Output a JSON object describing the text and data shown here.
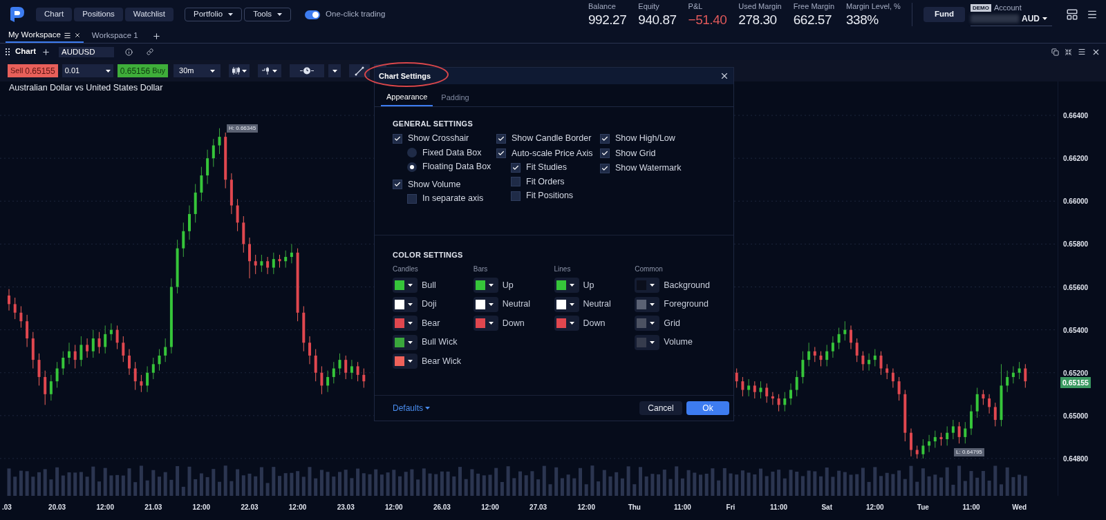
{
  "top_nav": {
    "buttons": [
      "Chart",
      "Positions",
      "Watchlist"
    ],
    "menus": [
      "Portfolio",
      "Tools"
    ],
    "one_click": {
      "label": "One-click trading",
      "on": true
    }
  },
  "account_stats": [
    {
      "label": "Balance",
      "value": "992.27",
      "kind": "normal"
    },
    {
      "label": "Equity",
      "value": "940.87",
      "kind": "normal"
    },
    {
      "label": "P&L",
      "value": "−51.40",
      "kind": "loss"
    },
    {
      "label": "Used Margin",
      "value": "278.30",
      "kind": "normal"
    },
    {
      "label": "Free Margin",
      "value": "662.57",
      "kind": "normal"
    },
    {
      "label": "Margin Level, %",
      "value": "338%",
      "kind": "normal"
    }
  ],
  "fund_button": "Fund",
  "account": {
    "badge": "DEMO",
    "label": "Account",
    "currency": "AUD"
  },
  "workspace_tabs": [
    {
      "label": "My Workspace",
      "selected": true
    },
    {
      "label": "Workspace 1",
      "selected": false
    }
  ],
  "chart_panel": {
    "title": "Chart",
    "symbol": "AUDUSD"
  },
  "toolbar": {
    "sell": {
      "label": "Sell",
      "price": "0.65155"
    },
    "quantity": "0.01",
    "buy": {
      "price": "0.65156",
      "label": "Buy"
    },
    "timeframe": "30m"
  },
  "instrument_title": "Australian Dollar vs United States Dollar",
  "chart_data": {
    "type": "candlestick",
    "yticks": [
      {
        "value": 0.664,
        "label": "0.66400"
      },
      {
        "value": 0.662,
        "label": "0.66200"
      },
      {
        "value": 0.66,
        "label": "0.66000"
      },
      {
        "value": 0.658,
        "label": "0.65800"
      },
      {
        "value": 0.656,
        "label": "0.65600"
      },
      {
        "value": 0.654,
        "label": "0.65400"
      },
      {
        "value": 0.652,
        "label": "0.65200"
      },
      {
        "value": 0.65,
        "label": "0.65000"
      },
      {
        "value": 0.648,
        "label": "0.64800"
      }
    ],
    "ylim": [
      0.64626,
      0.66558
    ],
    "grid": true,
    "ohlc": [
      [
        0.6556,
        0.6559,
        0.6549,
        0.6552
      ],
      [
        0.6552,
        0.6555,
        0.6545,
        0.6548
      ],
      [
        0.6548,
        0.6551,
        0.6541,
        0.6544
      ],
      [
        0.6544,
        0.6547,
        0.6532,
        0.6536
      ],
      [
        0.6536,
        0.6539,
        0.6522,
        0.6526
      ],
      [
        0.6526,
        0.6529,
        0.6514,
        0.6518
      ],
      [
        0.6518,
        0.6521,
        0.6505,
        0.651
      ],
      [
        0.651,
        0.6519,
        0.6507,
        0.6516
      ],
      [
        0.6516,
        0.6525,
        0.6513,
        0.6522
      ],
      [
        0.6522,
        0.653,
        0.6519,
        0.6527
      ],
      [
        0.6527,
        0.6534,
        0.6524,
        0.653
      ],
      [
        0.653,
        0.6533,
        0.6522,
        0.6526
      ],
      [
        0.6526,
        0.6537,
        0.6523,
        0.6533
      ],
      [
        0.6533,
        0.6536,
        0.6527,
        0.653
      ],
      [
        0.653,
        0.654,
        0.6527,
        0.6536
      ],
      [
        0.6536,
        0.6539,
        0.6529,
        0.6532
      ],
      [
        0.6532,
        0.6542,
        0.6529,
        0.6538
      ],
      [
        0.6538,
        0.6543,
        0.6535,
        0.654
      ],
      [
        0.654,
        0.6542,
        0.6531,
        0.6534
      ],
      [
        0.6534,
        0.6537,
        0.6525,
        0.6528
      ],
      [
        0.6528,
        0.6531,
        0.6519,
        0.6522
      ],
      [
        0.6522,
        0.6525,
        0.6512,
        0.6516
      ],
      [
        0.6516,
        0.6519,
        0.6511,
        0.6514
      ],
      [
        0.6514,
        0.6523,
        0.6511,
        0.652
      ],
      [
        0.652,
        0.6527,
        0.6517,
        0.6524
      ],
      [
        0.6524,
        0.6531,
        0.6521,
        0.6528
      ],
      [
        0.6528,
        0.6536,
        0.6525,
        0.6532
      ],
      [
        0.6532,
        0.6564,
        0.6529,
        0.656
      ],
      [
        0.656,
        0.6582,
        0.6557,
        0.6578
      ],
      [
        0.6578,
        0.659,
        0.6574,
        0.6586
      ],
      [
        0.6586,
        0.6598,
        0.6582,
        0.6594
      ],
      [
        0.6594,
        0.6608,
        0.659,
        0.6604
      ],
      [
        0.6604,
        0.6616,
        0.66,
        0.6612
      ],
      [
        0.6612,
        0.6624,
        0.6608,
        0.662
      ],
      [
        0.662,
        0.6629,
        0.6616,
        0.6626
      ],
      [
        0.6626,
        0.6634,
        0.6622,
        0.663
      ],
      [
        0.663,
        0.6632,
        0.6606,
        0.661
      ],
      [
        0.661,
        0.6613,
        0.6594,
        0.6598
      ],
      [
        0.6598,
        0.6601,
        0.6586,
        0.659
      ],
      [
        0.659,
        0.6593,
        0.6576,
        0.658
      ],
      [
        0.658,
        0.6583,
        0.6564,
        0.6572
      ],
      [
        0.6572,
        0.6575,
        0.6566,
        0.657
      ],
      [
        0.657,
        0.6575,
        0.6567,
        0.6572
      ],
      [
        0.6572,
        0.6574,
        0.6566,
        0.6569
      ],
      [
        0.6569,
        0.6576,
        0.6566,
        0.6573
      ],
      [
        0.6573,
        0.6575,
        0.6569,
        0.6572
      ],
      [
        0.6572,
        0.6577,
        0.6569,
        0.6574
      ],
      [
        0.6574,
        0.658,
        0.6571,
        0.6576
      ],
      [
        0.6576,
        0.6578,
        0.6544,
        0.6548
      ],
      [
        0.6548,
        0.6551,
        0.653,
        0.6534
      ],
      [
        0.6534,
        0.6537,
        0.6524,
        0.6528
      ],
      [
        0.6528,
        0.6531,
        0.6516,
        0.652
      ],
      [
        0.652,
        0.6523,
        0.651,
        0.6514
      ],
      [
        0.6514,
        0.6521,
        0.6511,
        0.6518
      ],
      [
        0.6518,
        0.6525,
        0.6515,
        0.6522
      ],
      [
        0.6522,
        0.6529,
        0.6519,
        0.6526
      ],
      [
        0.6526,
        0.6528,
        0.6517,
        0.652
      ],
      [
        0.652,
        0.6526,
        0.6517,
        0.6523
      ],
      [
        0.6523,
        0.6525,
        0.6516,
        0.6519
      ],
      [
        0.6519,
        0.6522,
        0.6513,
        0.6516
      ],
      null,
      null,
      null,
      null,
      null,
      null,
      null,
      null,
      null,
      null,
      null,
      null,
      null,
      null,
      null,
      null,
      null,
      null,
      null,
      null,
      null,
      null,
      null,
      null,
      null,
      null,
      null,
      null,
      null,
      null,
      null,
      null,
      null,
      null,
      null,
      null,
      null,
      null,
      null,
      null,
      null,
      null,
      null,
      null,
      null,
      null,
      null,
      null,
      null,
      null,
      null,
      null,
      null,
      null,
      null,
      null,
      null,
      null,
      null,
      null,
      null,
      [
        0.652,
        0.6522,
        0.6513,
        0.6516
      ],
      [
        0.6516,
        0.6518,
        0.6509,
        0.6512
      ],
      [
        0.6512,
        0.6517,
        0.6509,
        0.6514
      ],
      [
        0.6514,
        0.6516,
        0.6508,
        0.6511
      ],
      [
        0.6511,
        0.6516,
        0.6508,
        0.6513
      ],
      [
        0.6513,
        0.6515,
        0.6506,
        0.6509
      ],
      [
        0.6509,
        0.6511,
        0.6505,
        0.6508
      ],
      [
        0.6508,
        0.651,
        0.6502,
        0.6505
      ],
      [
        0.6505,
        0.6511,
        0.6502,
        0.6508
      ],
      [
        0.6508,
        0.6515,
        0.6505,
        0.6512
      ],
      [
        0.6512,
        0.6521,
        0.6509,
        0.6518
      ],
      [
        0.6518,
        0.653,
        0.6515,
        0.6526
      ],
      [
        0.6526,
        0.6534,
        0.6523,
        0.653
      ],
      [
        0.653,
        0.6532,
        0.6525,
        0.6528
      ],
      [
        0.6528,
        0.653,
        0.6523,
        0.6526
      ],
      [
        0.6526,
        0.6533,
        0.6523,
        0.653
      ],
      [
        0.653,
        0.6537,
        0.6527,
        0.6534
      ],
      [
        0.6534,
        0.6541,
        0.6531,
        0.6538
      ],
      [
        0.6538,
        0.6544,
        0.6535,
        0.654
      ],
      [
        0.654,
        0.6542,
        0.6531,
        0.6534
      ],
      [
        0.6534,
        0.6536,
        0.6525,
        0.6528
      ],
      [
        0.6528,
        0.653,
        0.6521,
        0.6524
      ],
      [
        0.6524,
        0.6529,
        0.6521,
        0.6526
      ],
      [
        0.6526,
        0.6531,
        0.6523,
        0.6528
      ],
      [
        0.6528,
        0.653,
        0.6519,
        0.6522
      ],
      [
        0.6522,
        0.6524,
        0.6517,
        0.652
      ],
      [
        0.652,
        0.6522,
        0.6513,
        0.6516
      ],
      [
        0.6516,
        0.6518,
        0.6507,
        0.651
      ],
      [
        0.651,
        0.6512,
        0.6488,
        0.6492
      ],
      [
        0.6492,
        0.6494,
        0.6481,
        0.6484
      ],
      [
        0.6484,
        0.6486,
        0.648,
        0.6482
      ],
      [
        0.6482,
        0.6489,
        0.648,
        0.6486
      ],
      [
        0.6486,
        0.6491,
        0.6483,
        0.6488
      ],
      [
        0.6488,
        0.6493,
        0.6485,
        0.649
      ],
      [
        0.649,
        0.6492,
        0.6486,
        0.6489
      ],
      [
        0.6489,
        0.6495,
        0.6486,
        0.6492
      ],
      [
        0.6492,
        0.6498,
        0.6489,
        0.6495
      ],
      [
        0.6495,
        0.6497,
        0.6487,
        0.649
      ],
      [
        0.649,
        0.6497,
        0.6487,
        0.6494
      ],
      [
        0.6494,
        0.6505,
        0.6491,
        0.6502
      ],
      [
        0.6502,
        0.6513,
        0.6499,
        0.651
      ],
      [
        0.651,
        0.6512,
        0.6505,
        0.6508
      ],
      [
        0.6508,
        0.651,
        0.6501,
        0.6504
      ],
      [
        0.6504,
        0.6506,
        0.6495,
        0.6498
      ],
      [
        0.6498,
        0.6524,
        0.6495,
        0.6514
      ],
      [
        0.6514,
        0.6521,
        0.6511,
        0.6518
      ],
      [
        0.6518,
        0.6523,
        0.6515,
        0.652
      ],
      [
        0.652,
        0.6525,
        0.6517,
        0.6522
      ],
      [
        0.6522,
        0.6524,
        0.6513,
        0.6516
      ]
    ]
  },
  "time_axis": [
    ".03",
    "20.03",
    "12:00",
    "21.03",
    "12:00",
    "22.03",
    "12:00",
    "23.03",
    "12:00",
    "26.03",
    "12:00",
    "27.03",
    "12:00",
    "Thu",
    "11:00",
    "Fri",
    "11:00",
    "Sat",
    "12:00",
    "Tue",
    "11:00",
    "Wed"
  ],
  "current_price": "0.65155",
  "high_label": "H: 0.66345",
  "low_label": "L: 0.64795",
  "dialog": {
    "title": "Chart Settings",
    "tabs": [
      {
        "label": "Appearance",
        "selected": true
      },
      {
        "label": "Padding",
        "selected": false
      }
    ],
    "general_title": "GENERAL SETTINGS",
    "general_columns": [
      [
        {
          "kind": "checkbox",
          "label": "Show Crosshair",
          "checked": true,
          "children": [
            {
              "kind": "radio",
              "label": "Fixed Data Box",
              "selected": false
            },
            {
              "kind": "radio",
              "label": "Floating Data Box",
              "selected": true
            }
          ]
        },
        {
          "kind": "checkbox",
          "label": "Show Volume",
          "checked": true,
          "children": [
            {
              "kind": "checkbox",
              "label": "In separate axis",
              "checked": false
            }
          ]
        }
      ],
      [
        {
          "kind": "checkbox",
          "label": "Show Candle Border",
          "checked": true
        },
        {
          "kind": "checkbox",
          "label": "Auto-scale Price Axis",
          "checked": true,
          "children": [
            {
              "kind": "checkbox",
              "label": "Fit Studies",
              "checked": true
            },
            {
              "kind": "checkbox",
              "label": "Fit Orders",
              "checked": false
            },
            {
              "kind": "checkbox",
              "label": "Fit Positions",
              "checked": false
            }
          ]
        }
      ],
      [
        {
          "kind": "checkbox",
          "label": "Show High/Low",
          "checked": true
        },
        {
          "kind": "checkbox",
          "label": "Show Grid",
          "checked": true
        },
        {
          "kind": "checkbox",
          "label": "Show Watermark",
          "checked": true
        }
      ]
    ],
    "color_title": "COLOR SETTINGS",
    "color_groups": [
      {
        "title": "Candles",
        "items": [
          {
            "label": "Bull",
            "color": "#36c53a"
          },
          {
            "label": "Doji",
            "color": "#ffffff"
          },
          {
            "label": "Bear",
            "color": "#e0474f"
          },
          {
            "label": "Bull Wick",
            "color": "#3aa73c"
          },
          {
            "label": "Bear Wick",
            "color": "#f0625a"
          }
        ]
      },
      {
        "title": "Bars",
        "items": [
          {
            "label": "Up",
            "color": "#36c53a"
          },
          {
            "label": "Neutral",
            "color": "#ffffff"
          },
          {
            "label": "Down",
            "color": "#e0474f"
          }
        ]
      },
      {
        "title": "Lines",
        "items": [
          {
            "label": "Up",
            "color": "#36c53a"
          },
          {
            "label": "Neutral",
            "color": "#ffffff"
          },
          {
            "label": "Down",
            "color": "#e0474f"
          }
        ]
      },
      {
        "title": "Common",
        "items": [
          {
            "label": "Background",
            "color": "#0b0f1c"
          },
          {
            "label": "Foreground",
            "color": "#5b6274"
          },
          {
            "label": "Grid",
            "color": "#4c5262"
          },
          {
            "label": "Volume",
            "color": "#363c4d"
          }
        ]
      }
    ],
    "defaults": "Defaults",
    "cancel": "Cancel",
    "ok": "Ok"
  }
}
